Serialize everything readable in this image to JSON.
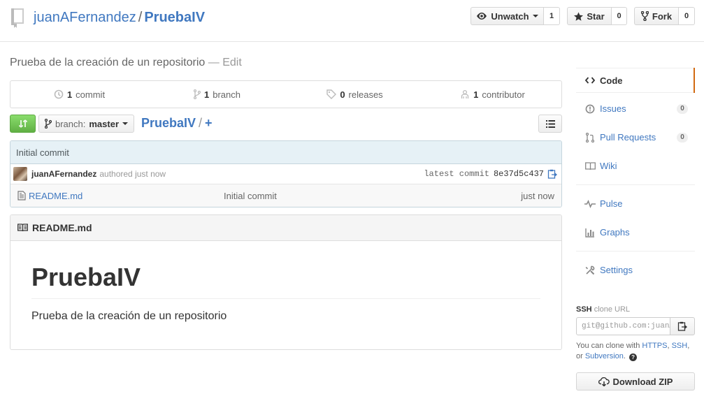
{
  "header": {
    "owner": "juanAFernandez",
    "separator": "/",
    "repo": "PruebaIV",
    "watch_label": "Unwatch",
    "watch_count": "1",
    "star_label": "Star",
    "star_count": "0",
    "fork_label": "Fork",
    "fork_count": "0"
  },
  "description": {
    "text": "Prueba de la creación de un repositorio",
    "edit": "— Edit"
  },
  "summary": {
    "commits_n": "1",
    "commits_label": "commit",
    "branches_n": "1",
    "branches_label": "branch",
    "releases_n": "0",
    "releases_label": "releases",
    "contributors_n": "1",
    "contributors_label": "contributor"
  },
  "filenav": {
    "branch_prefix": "branch:",
    "branch": "master",
    "root": "PruebaIV",
    "slash": "/",
    "plus": "+"
  },
  "commit": {
    "message": "Initial commit",
    "author": "juanAFernandez",
    "authored": "authored just now",
    "latest_label": "latest commit",
    "sha": "8e37d5c437"
  },
  "files": [
    {
      "name": "README.md",
      "message": "Initial commit",
      "age": "just now"
    }
  ],
  "readme": {
    "filename": "README.md",
    "heading": "PruebaIV",
    "paragraph": "Prueba de la creación de un repositorio"
  },
  "sidebar": {
    "code": "Code",
    "issues": "Issues",
    "issues_count": "0",
    "pulls": "Pull Requests",
    "pulls_count": "0",
    "wiki": "Wiki",
    "pulse": "Pulse",
    "graphs": "Graphs",
    "settings": "Settings"
  },
  "clone": {
    "protocol": "SSH",
    "label": "clone URL",
    "url": "git@github.com:juanAFernandez/PruebaIV.git",
    "help_prefix": "You can clone with",
    "https": "HTTPS",
    "ssh": "SSH",
    "or": "or",
    "svn": "Subversion",
    "download": "Download ZIP"
  },
  "colors": {
    "link": "#4078c0",
    "accent_selected": "#d26911",
    "compare_green": "#60b044"
  }
}
